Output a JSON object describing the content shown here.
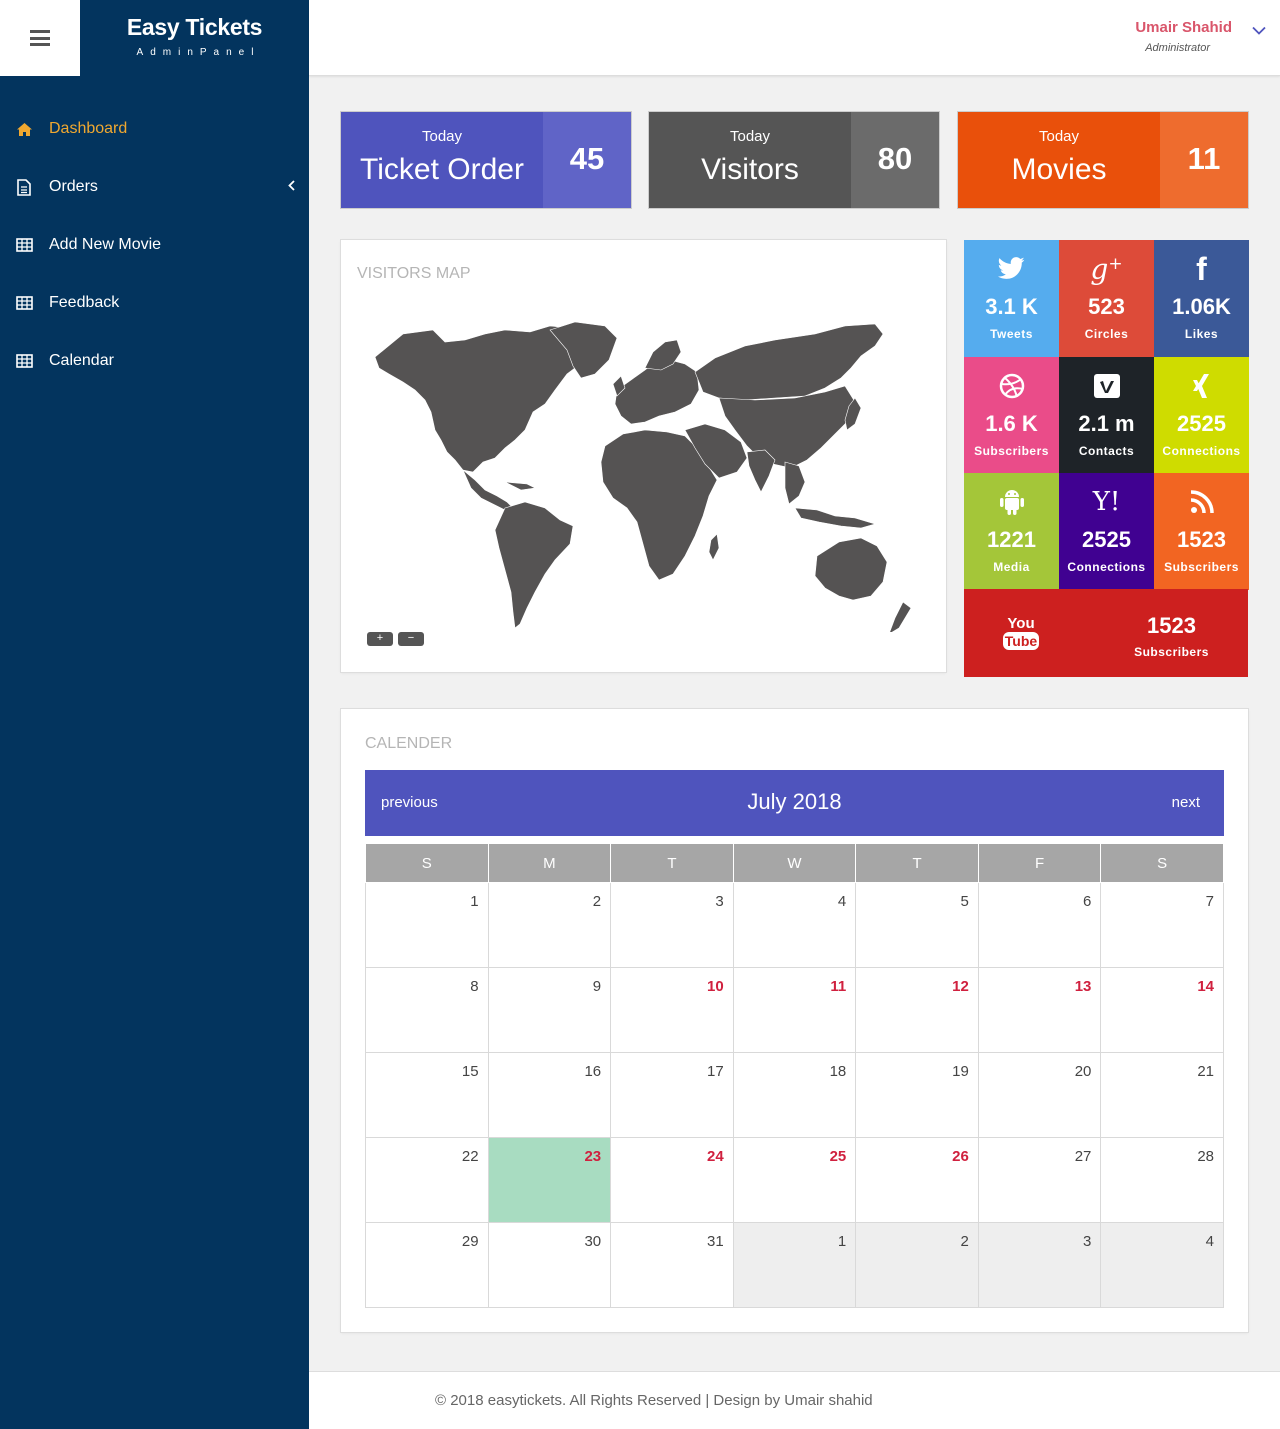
{
  "brand": {
    "title": "Easy Tickets",
    "subtitle": "AdminPanel"
  },
  "sidebar": {
    "items": [
      {
        "label": "Dashboard",
        "icon": "home-icon",
        "active": true
      },
      {
        "label": "Orders",
        "icon": "document-icon",
        "has_submenu": true
      },
      {
        "label": "Add New Movie",
        "icon": "table-icon"
      },
      {
        "label": "Feedback",
        "icon": "table-icon"
      },
      {
        "label": "Calendar",
        "icon": "table-icon"
      }
    ]
  },
  "user": {
    "name": "Umair Shahid",
    "role": "Administrator"
  },
  "stats": [
    {
      "caption": "Today",
      "label": "Ticket Order",
      "value": "45",
      "color": "#4f54bd",
      "value_color": "#6064c7"
    },
    {
      "caption": "Today",
      "label": "Visitors",
      "value": "80",
      "color": "#555555",
      "value_color": "#6b6b6b"
    },
    {
      "caption": "Today",
      "label": "Movies",
      "value": "11",
      "color": "#e9500b",
      "value_color": "#ee6c2e"
    }
  ],
  "map": {
    "title": "VISITORS MAP",
    "zoom_in": "+",
    "zoom_out": "−"
  },
  "social": [
    {
      "network": "twitter",
      "icon": "twitter-icon",
      "value": "3.1 K",
      "label": "Tweets",
      "color": "#55acee"
    },
    {
      "network": "google-plus",
      "icon": "google-plus-icon",
      "value": "523",
      "label": "Circles",
      "color": "#dd4b39"
    },
    {
      "network": "facebook",
      "icon": "facebook-icon",
      "value": "1.06K",
      "label": "Likes",
      "color": "#3b5998"
    },
    {
      "network": "dribbble",
      "icon": "dribbble-icon",
      "value": "1.6 K",
      "label": "Subscribers",
      "color": "#ea4c89"
    },
    {
      "network": "vimeo",
      "icon": "vimeo-icon",
      "value": "2.1 m",
      "label": "Contacts",
      "color": "#1e2328"
    },
    {
      "network": "xing",
      "icon": "xing-icon",
      "value": "2525",
      "label": "Connections",
      "color": "#cfdc00"
    },
    {
      "network": "android",
      "icon": "android-icon",
      "value": "1221",
      "label": "Media",
      "color": "#a4c639"
    },
    {
      "network": "yahoo",
      "icon": "yahoo-icon",
      "value": "2525",
      "label": "Connections",
      "color": "#400191"
    },
    {
      "network": "rss",
      "icon": "rss-icon",
      "value": "1523",
      "label": "Subscribers",
      "color": "#f26522"
    },
    {
      "network": "youtube",
      "icon": "youtube-icon",
      "value": "1523",
      "label": "Subscribers",
      "color": "#cd201f"
    }
  ],
  "calendar": {
    "title": "CALENDER",
    "previous": "previous",
    "next": "next",
    "month": "July 2018",
    "weekdays": [
      "S",
      "M",
      "T",
      "W",
      "T",
      "F",
      "S"
    ],
    "weeks": [
      [
        {
          "d": "1"
        },
        {
          "d": "2"
        },
        {
          "d": "3"
        },
        {
          "d": "4"
        },
        {
          "d": "5"
        },
        {
          "d": "6"
        },
        {
          "d": "7"
        }
      ],
      [
        {
          "d": "8"
        },
        {
          "d": "9"
        },
        {
          "d": "10",
          "event": true
        },
        {
          "d": "11",
          "event": true
        },
        {
          "d": "12",
          "event": true
        },
        {
          "d": "13",
          "event": true
        },
        {
          "d": "14",
          "event": true
        }
      ],
      [
        {
          "d": "15"
        },
        {
          "d": "16"
        },
        {
          "d": "17"
        },
        {
          "d": "18"
        },
        {
          "d": "19"
        },
        {
          "d": "20"
        },
        {
          "d": "21"
        }
      ],
      [
        {
          "d": "22"
        },
        {
          "d": "23",
          "event": true,
          "today": true
        },
        {
          "d": "24",
          "event": true
        },
        {
          "d": "25",
          "event": true
        },
        {
          "d": "26",
          "event": true
        },
        {
          "d": "27"
        },
        {
          "d": "28"
        }
      ],
      [
        {
          "d": "29"
        },
        {
          "d": "30"
        },
        {
          "d": "31"
        },
        {
          "d": "1",
          "other": true
        },
        {
          "d": "2",
          "other": true
        },
        {
          "d": "3",
          "other": true
        },
        {
          "d": "4",
          "other": true
        }
      ]
    ]
  },
  "footer": {
    "text": "© 2018 easytickets. All Rights Reserved | Design by Umair shahid"
  }
}
